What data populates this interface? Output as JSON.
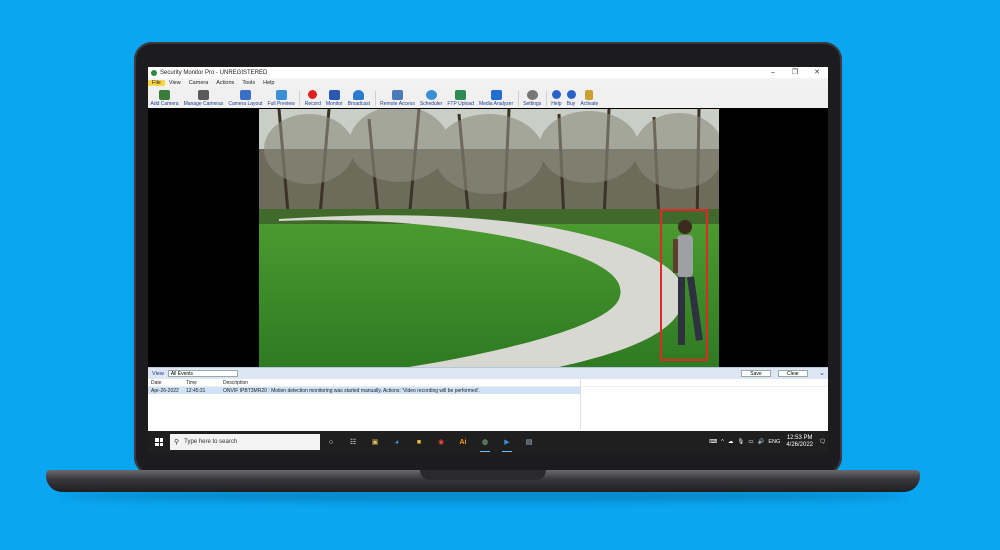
{
  "window": {
    "title": "Security Monitor Pro - UNREGISTERED",
    "controls": {
      "minimize": "–",
      "maximize": "❐",
      "close": "✕"
    }
  },
  "menu": [
    "File",
    "View",
    "Camera",
    "Actions",
    "Tools",
    "Help"
  ],
  "toolbar": [
    {
      "label": "Add Camera",
      "icon": "add-camera-icon",
      "color": "#3a7d3a"
    },
    {
      "label": "Manage Cameras",
      "icon": "manage-cameras-icon",
      "color": "#5a5a5a"
    },
    {
      "label": "Camera Layout",
      "icon": "camera-layout-icon",
      "color": "#3b6fc6"
    },
    {
      "label": "Full Preview",
      "icon": "full-preview-icon",
      "color": "#3b8fd6"
    },
    {
      "label": "Record",
      "icon": "record-icon",
      "color": "#e02020"
    },
    {
      "label": "Monitor",
      "icon": "monitor-icon",
      "color": "#2a58b0"
    },
    {
      "label": "Broadcast",
      "icon": "broadcast-icon",
      "color": "#2a7ad0"
    },
    {
      "label": "Remote Access",
      "icon": "remote-access-icon",
      "color": "#4a7ab8"
    },
    {
      "label": "Scheduler",
      "icon": "scheduler-icon",
      "color": "#3b8fd6"
    },
    {
      "label": "FTP Upload",
      "icon": "ftp-upload-icon",
      "color": "#2e8b57"
    },
    {
      "label": "Media Analyzer",
      "icon": "media-analyzer-icon",
      "color": "#1f6fd1"
    },
    {
      "label": "Settings",
      "icon": "settings-icon",
      "color": "#777777"
    },
    {
      "label": "Help",
      "icon": "help-icon",
      "color": "#2a62c9"
    },
    {
      "label": "Buy",
      "icon": "buy-icon",
      "color": "#2a62c9"
    },
    {
      "label": "Activate",
      "icon": "activate-icon",
      "color": "#caa032"
    }
  ],
  "events": {
    "view_label": "View",
    "filter_value": "All Events",
    "save_label": "Save",
    "clear_label": "Clear",
    "columns": [
      "Date",
      "Time",
      "Description"
    ],
    "rows": [
      {
        "date": "Apr-26-2022",
        "time": "12:45:31",
        "description": "ONVIF IPBT3MR20 : Motion detection monitoring was started manually. Actions: 'Video recording will be performed'."
      }
    ]
  },
  "taskbar": {
    "search_placeholder": "Type here to search",
    "apps": [
      "task-view-icon",
      "widgets-icon",
      "file-explorer-icon",
      "edge-icon",
      "folder-icon",
      "chrome-icon",
      "illustrator-icon",
      "security-monitor-icon",
      "media-player-icon",
      "files-icon"
    ],
    "illustrator_text": "Ai",
    "tray": {
      "language": "ENG",
      "time": "12:53 PM",
      "date": "4/26/2022"
    }
  },
  "colors": {
    "detection_box": "#e32626",
    "background": "#0aa6f2"
  }
}
